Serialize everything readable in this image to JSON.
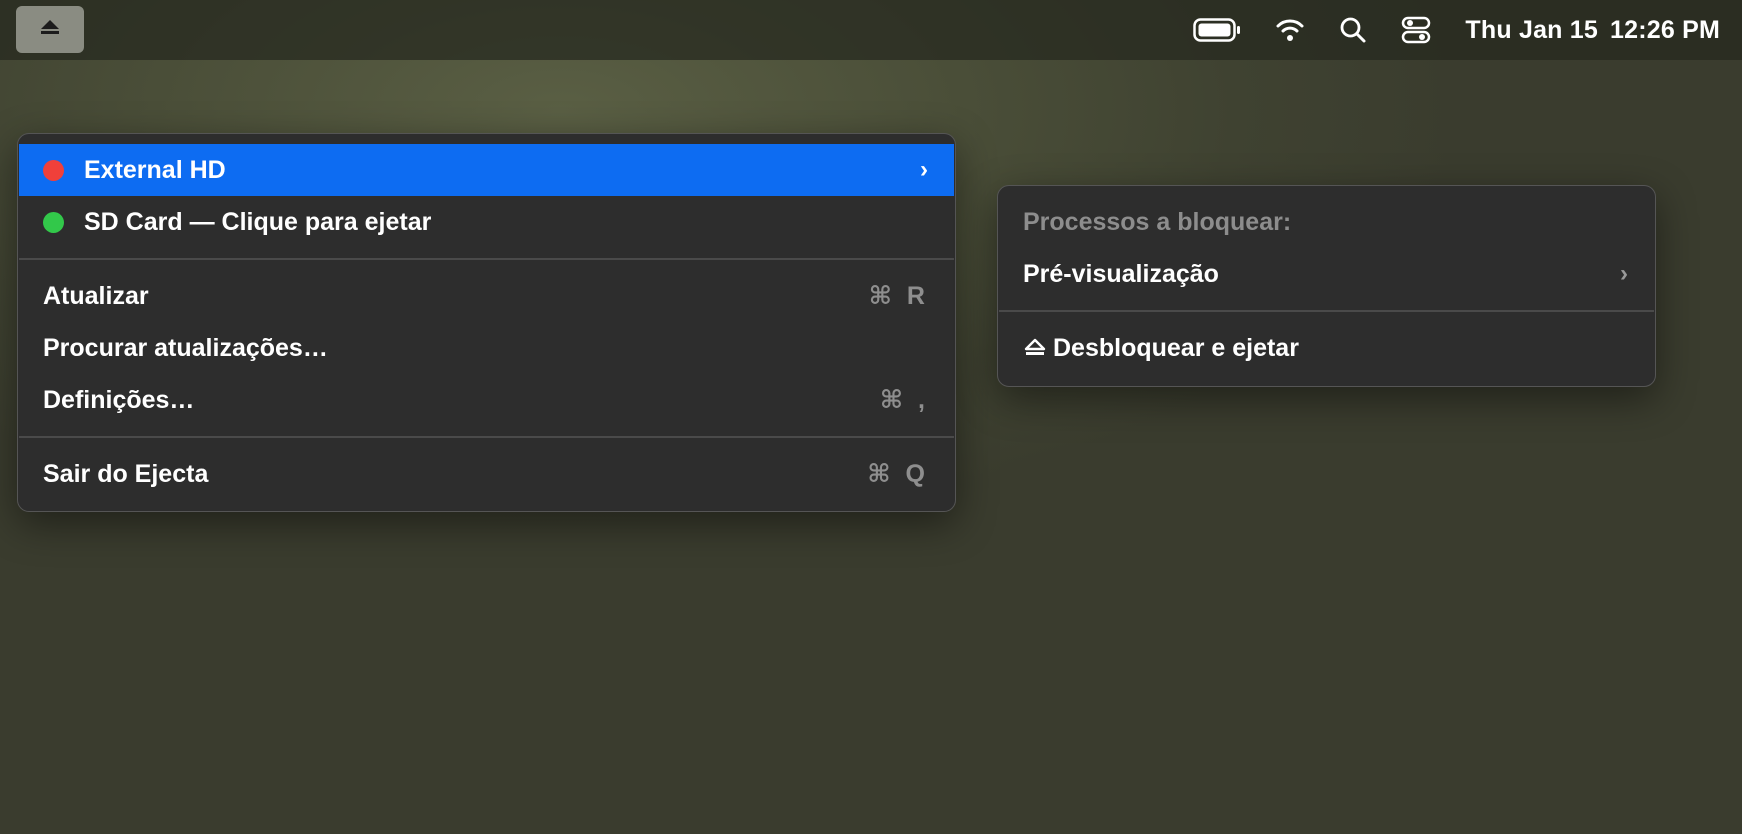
{
  "menubar": {
    "app_icon": "eject-icon",
    "status_icons": [
      "battery-icon",
      "wifi-icon",
      "search-icon",
      "control-center-icon"
    ],
    "date": "Thu Jan 15",
    "time": "12:26 PM"
  },
  "main_menu": {
    "drives": [
      {
        "label": "External HD",
        "status_color": "#f0403a",
        "highlighted": true,
        "has_submenu": true
      },
      {
        "label": "SD Card — Clique para ejetar",
        "status_color": "#32c84a",
        "highlighted": false,
        "has_submenu": false
      }
    ],
    "actions": [
      {
        "label": "Atualizar",
        "shortcut": "⌘ R"
      },
      {
        "label": "Procurar atualizações…",
        "shortcut": ""
      },
      {
        "label": "Definições…",
        "shortcut": "⌘ ,"
      }
    ],
    "quit": {
      "label": "Sair do Ejecta",
      "shortcut": "⌘ Q"
    },
    "highlight_color": "#0d6cf2"
  },
  "sub_menu": {
    "header": "Processos a bloquear:",
    "preview_label": "Pré-visualização",
    "unlock_eject_icon": "eject-icon",
    "unlock_eject_label": "Desbloquear e ejetar"
  }
}
